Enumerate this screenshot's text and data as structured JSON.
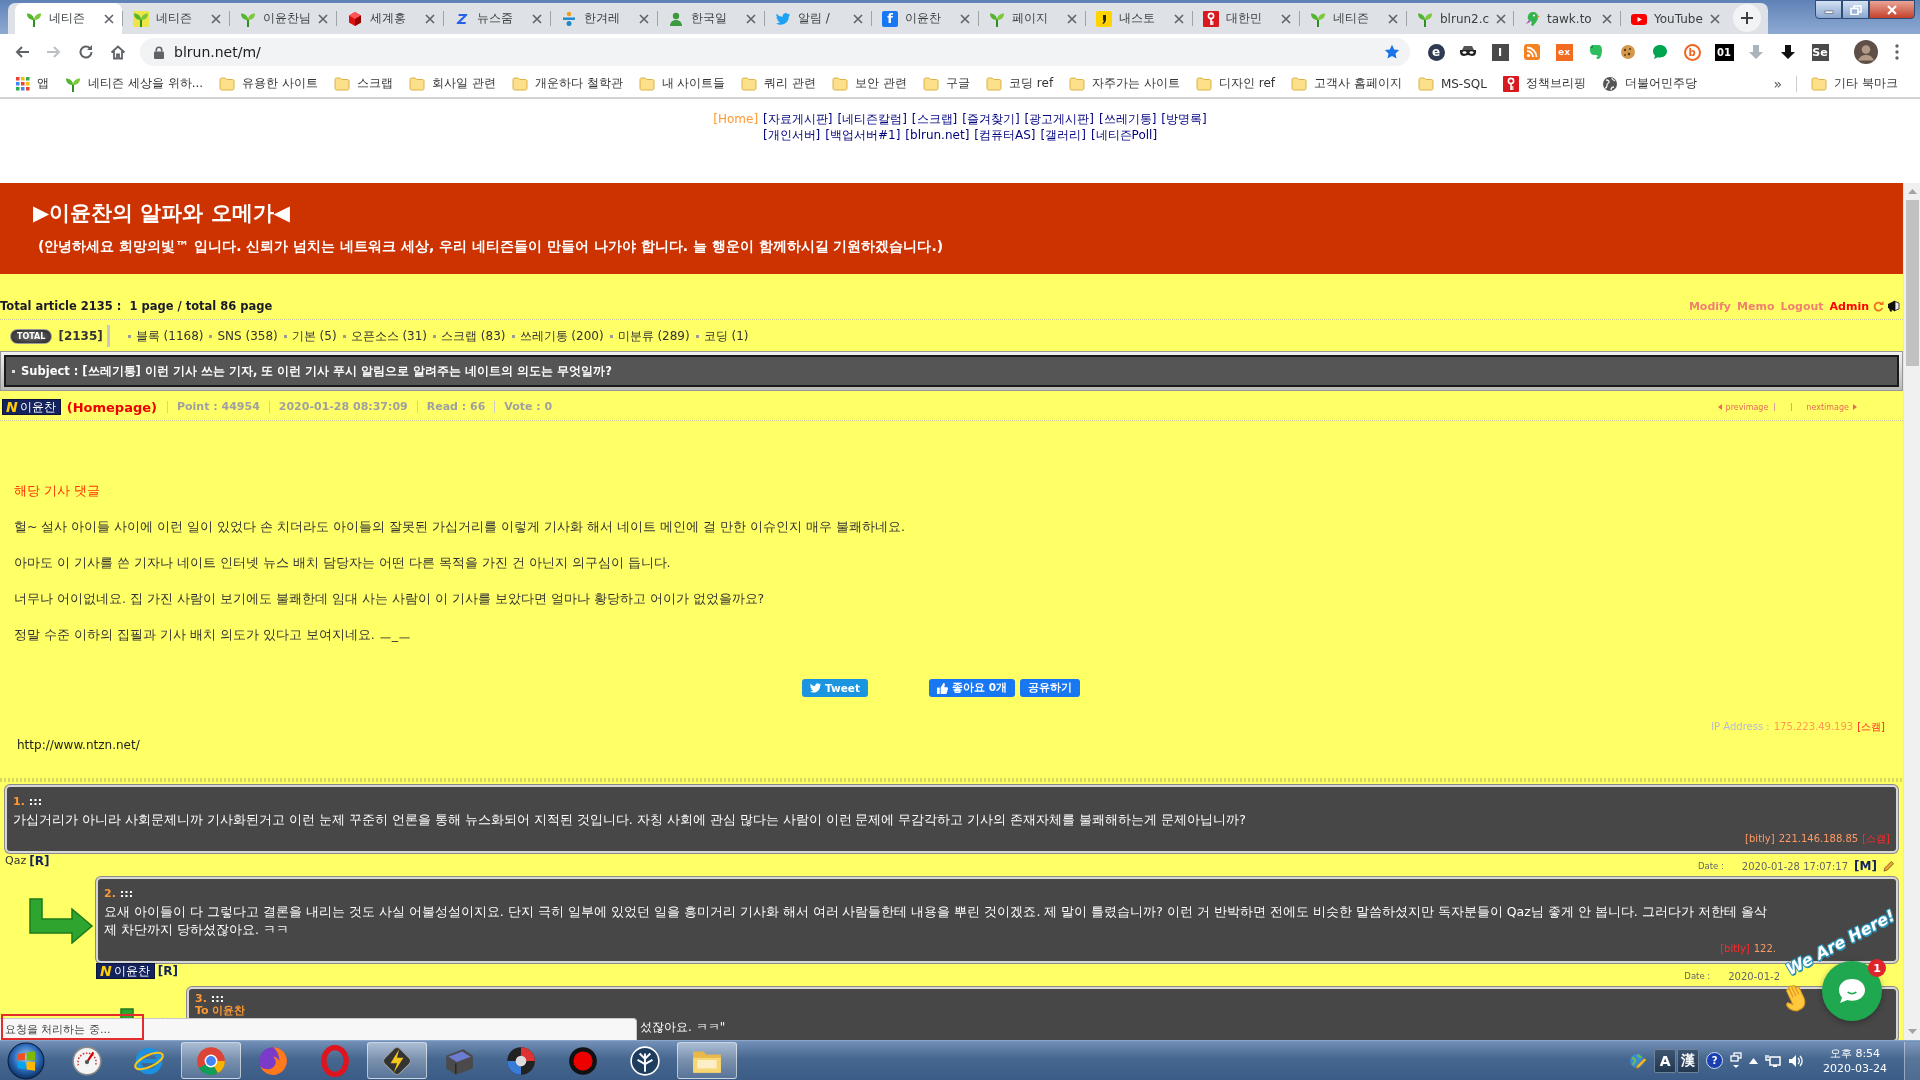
{
  "browser": {
    "tabs": [
      {
        "title": "네티즌",
        "kind": "sprout",
        "selected": true
      },
      {
        "title": "네티즌",
        "kind": "sprout-tile",
        "selected": false
      },
      {
        "title": "이윤찬님",
        "kind": "sprout",
        "selected": false
      },
      {
        "title": "세계홍",
        "kind": "gem",
        "selected": false
      },
      {
        "title": "뉴스줌",
        "kind": "glyph",
        "glyph": "Z",
        "selected": false
      },
      {
        "title": "한겨레",
        "kind": "figure",
        "selected": false
      },
      {
        "title": "한국일",
        "kind": "person",
        "selected": false
      },
      {
        "title": "알림 /",
        "kind": "bird",
        "selected": false
      },
      {
        "title": "이윤찬",
        "kind": "glyph-tile",
        "glyph": "f",
        "selected": false
      },
      {
        "title": "페이지",
        "kind": "sprout",
        "selected": false
      },
      {
        "title": "내스토",
        "kind": "comma",
        "selected": false
      },
      {
        "title": "대한민",
        "kind": "key",
        "selected": false
      },
      {
        "title": "네티즌",
        "kind": "sprout",
        "selected": false
      },
      {
        "title": "blrun2.c",
        "kind": "sprout",
        "selected": false
      },
      {
        "title": "tawk.to",
        "kind": "parrot",
        "selected": false
      },
      {
        "title": "YouTube",
        "kind": "play",
        "selected": false
      }
    ],
    "address": "blrun.net/m/",
    "extensions": [
      {
        "kind": "disc",
        "text": "e"
      },
      {
        "kind": "mask"
      },
      {
        "kind": "tile",
        "text": "I"
      },
      {
        "kind": "rss"
      },
      {
        "kind": "tile-orange",
        "text": "ex"
      },
      {
        "kind": "elephant"
      },
      {
        "kind": "cookie"
      },
      {
        "kind": "bubble"
      },
      {
        "kind": "ring",
        "text": "b"
      },
      {
        "kind": "tile-black",
        "text": "01"
      },
      {
        "kind": "arrow-gray"
      },
      {
        "kind": "arrow-black"
      },
      {
        "kind": "tile",
        "text": "Se"
      }
    ],
    "bookmarks": [
      {
        "label": "앱",
        "kind": "apps"
      },
      {
        "label": "네티즌 세상을 위하...",
        "kind": "sprout"
      },
      {
        "label": "유용한 사이트",
        "kind": "folder"
      },
      {
        "label": "스크랩",
        "kind": "folder"
      },
      {
        "label": "회사일 관련",
        "kind": "folder"
      },
      {
        "label": "개운하다 철학관",
        "kind": "folder"
      },
      {
        "label": "내 사이트들",
        "kind": "folder"
      },
      {
        "label": "쿼리 관련",
        "kind": "folder"
      },
      {
        "label": "보안 관련",
        "kind": "folder"
      },
      {
        "label": "구글",
        "kind": "folder"
      },
      {
        "label": "코딩 ref",
        "kind": "folder"
      },
      {
        "label": "자주가는 사이트",
        "kind": "folder"
      },
      {
        "label": "디자인 ref",
        "kind": "folder"
      },
      {
        "label": "고객사 홈페이지",
        "kind": "folder"
      },
      {
        "label": "MS-SQL",
        "kind": "folder"
      },
      {
        "label": "정책브리핑",
        "kind": "key"
      },
      {
        "label": "더불어민주당",
        "kind": "globe"
      }
    ],
    "bookmarks_more": "»",
    "other_bookmarks": "기타 북마크"
  },
  "site_nav": {
    "first_line": [
      {
        "label": "[Home]",
        "selected": true
      },
      {
        "label": "[자료게시판]",
        "selected": false
      },
      {
        "label": "[네티즌칼럼]",
        "selected": false
      },
      {
        "label": "[스크랩]",
        "selected": false
      },
      {
        "label": "[즐겨찾기]",
        "selected": false
      },
      {
        "label": "[광고게시판]",
        "selected": false
      },
      {
        "label": "[쓰레기통]",
        "selected": false
      },
      {
        "label": "[방명록]",
        "selected": false
      }
    ],
    "second_line": [
      {
        "label": "[개인서버]",
        "selected": false
      },
      {
        "label": "[백업서버#1]",
        "selected": false
      },
      {
        "label": "[blrun.net]",
        "selected": false
      },
      {
        "label": "[컴퓨터AS]",
        "selected": false
      },
      {
        "label": "[갤러리]",
        "selected": false
      },
      {
        "label": "[네티즌Poll]",
        "selected": false
      }
    ]
  },
  "board": {
    "header": {
      "title": "▶이윤찬의 알파와 오메가◀",
      "subtitle": "(안녕하세요 희망의빛™ 입니다. 신뢰가 넘치는 네트워크 세상, 우리 네티즌들이 만들어 나가야 합니다. 늘 행운이 함께하시길 기원하겠습니다.)"
    },
    "summary": "Total article 2135 :  1 page / total 86 page",
    "admin_links": [
      {
        "label": "Modify",
        "active": false
      },
      {
        "label": "Memo",
        "active": false
      },
      {
        "label": "Logout",
        "active": false
      },
      {
        "label": "Admin",
        "active": true
      }
    ],
    "categories": {
      "badge": "TOTAL",
      "count": "[2135]",
      "items": [
        "블록 (1168)",
        "SNS (358)",
        "기본 (5)",
        "오픈소스 (31)",
        "스크랩 (83)",
        "쓰레기통 (200)",
        "미분류 (289)",
        "코딩 (1)"
      ]
    },
    "subject": "Subject : [쓰레기통] 이런 기사 쓰는 기자, 또 이런 기사 푸시 알림으로 알려주는 네이트의 의도는 무엇일까?",
    "post_info": {
      "author": {
        "level": "N",
        "name": "이윤찬"
      },
      "homepage": "(Homepage)",
      "fields": [
        "Point : 44954",
        "2020-01-28 08:37:09",
        "Read : 66",
        "Vote : 0"
      ],
      "prev": "previmage",
      "next": "nextimage"
    },
    "body": {
      "heading": "해당 기사 댓글",
      "paragraphs": [
        "헐~ 설사 아이들 사이에 이런 일이 있었다 손 치더라도 아이들의 잘못된 가십거리를 이렇게 기사화 해서 네이트 메인에 걸 만한 이슈인지 매우 불쾌하네요.",
        "아마도 이 기사를 쓴 기자나 네이트 인터넷 뉴스 배치 담당자는 어떤 다른 목적을 가진 건 아닌지 의구심이 듭니다.",
        "너무나 어이없네요. 집 가진 사람이 보기에도 불쾌한데 임대 사는 사람이 이 기사를 보았다면 얼마나 황당하고 어이가 없었을까요?",
        "정말 수준 이하의 집필과 기사 배치 의도가 있다고 보여지네요. ㅡ_ㅡ"
      ]
    },
    "share_buttons": [
      {
        "label": "Tweet",
        "kind": "tweet"
      },
      {
        "label": "좋아요 0개",
        "kind": "like"
      },
      {
        "label": "공유하기",
        "kind": "share"
      }
    ],
    "ip": {
      "label": "IP Address :",
      "address": "175.223.49.193",
      "action": "[스캠]"
    },
    "homepage_link": "http://www.ntzn.net/",
    "comments": [
      {
        "number": "1.",
        "marker": ":::",
        "text": "가십거리가 아니라 사회문제니까 기사화된거고 이런 눈제 꾸준히 언론을 통해 뉴스화되어 지적된 것입니다. 자칭 사회에 관심 많다는 사람이 이런 문제에 무감각하고 기사의 존재자체를 불쾌해하는게 문제아닙니까?",
        "source": "[bitly]",
        "ip": "221.146.188.85",
        "action": "[스캠]",
        "author": {
          "name": "Qaz"
        },
        "reply": "[R]",
        "date_label": "Date :",
        "date": "2020-01-28 17:07:17",
        "edit": "[M]",
        "children": [
          {
            "number": "2.",
            "marker": ":::",
            "text": "요새 아이들이 다 그렇다고 결론을 내리는 것도 사실 어불성설이지요. 단지 극히 일부에 있었던 일을 흥미거리 기사화 해서 여러 사람들한테 내용을 뿌린 것이겠죠. 제 말이 틀렸습니까? 이런 거 반박하면 전에도 비슷한 말씀하셨지만 독자분들이 Qaz님 좋게 안 봅니다. 그러다가 저한테 올삭제 차단까지 당하셨잖아요. ㅋㅋ",
            "source": "[bitly]",
            "ip": "122.",
            "author": {
              "level": "N",
              "name": "이윤찬"
            },
            "reply": "[R]",
            "date_label": "Date :",
            "date": "2020-01-2",
            "children": [
              {
                "number": "3.",
                "marker": ":::",
                "to": "To 이윤찬",
                "text_end": "섰잖아요. ㅋㅋ\""
              }
            ]
          }
        ]
      }
    ]
  },
  "status_bubble": "요청을 처리하는 중...",
  "chat_widget": {
    "banner": "We Are Here!",
    "badge": "1"
  },
  "taskbar": {
    "apps": [
      {
        "kind": "gauge",
        "running": false
      },
      {
        "kind": "e-logo",
        "running": false
      },
      {
        "kind": "wheel",
        "running": true
      },
      {
        "kind": "fox-globe",
        "running": false
      },
      {
        "kind": "ring",
        "running": false
      },
      {
        "kind": "lightning",
        "running": true
      },
      {
        "kind": "tablet",
        "running": false
      },
      {
        "kind": "disc",
        "running": false
      },
      {
        "kind": "record",
        "running": false
      },
      {
        "kind": "tree",
        "running": false
      },
      {
        "kind": "folder",
        "running": true
      }
    ],
    "tray": {
      "ime": [
        "A",
        "漢"
      ],
      "help": "?",
      "time": "오후 8:54",
      "date": "2020-03-24"
    }
  }
}
